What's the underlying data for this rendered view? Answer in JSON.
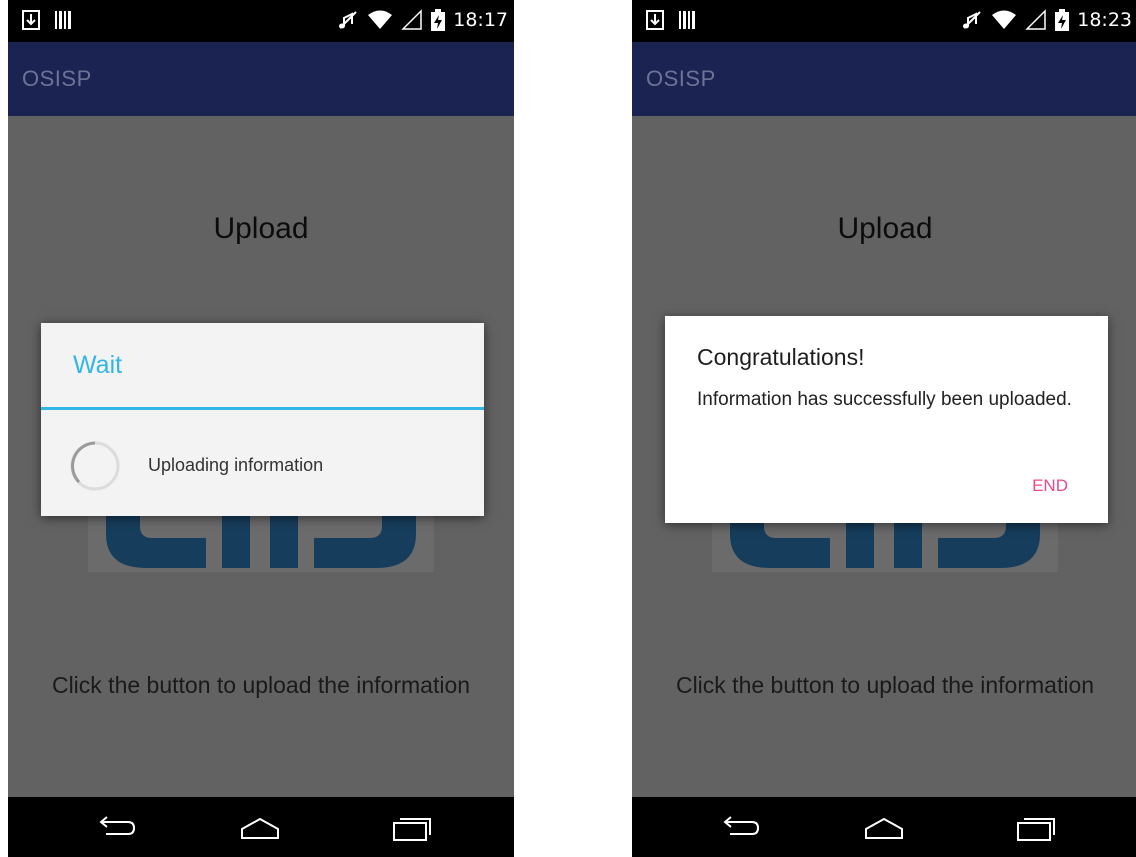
{
  "screens": [
    {
      "status": {
        "time": "18:17"
      },
      "app_bar": {
        "title": "OSISP"
      },
      "content": {
        "title": "Upload",
        "instruction": "Click the button to upload the information"
      },
      "dialog": {
        "type": "progress",
        "title": "Wait",
        "message": "Uploading information"
      }
    },
    {
      "status": {
        "time": "18:23"
      },
      "app_bar": {
        "title": "OSISP"
      },
      "content": {
        "title": "Upload",
        "instruction": "Click the button to upload the information"
      },
      "dialog": {
        "type": "alert",
        "title": "Congratulations!",
        "message": "Information has successfully been uploaded.",
        "button_label": "END"
      }
    }
  ],
  "icons": {
    "status_left": [
      "download-notification-icon",
      "barcode-notification-icon"
    ],
    "status_right": [
      "mute-icon",
      "wifi-icon",
      "signal-icon",
      "battery-charging-icon"
    ],
    "nav": [
      "back-icon",
      "home-icon",
      "recent-apps-icon"
    ]
  },
  "colors": {
    "app_bar": "#1b2353",
    "content_background": "#626262",
    "holo_accent": "#33b5e5",
    "end_button": "#e94a8c",
    "logo": "#163d5c"
  }
}
